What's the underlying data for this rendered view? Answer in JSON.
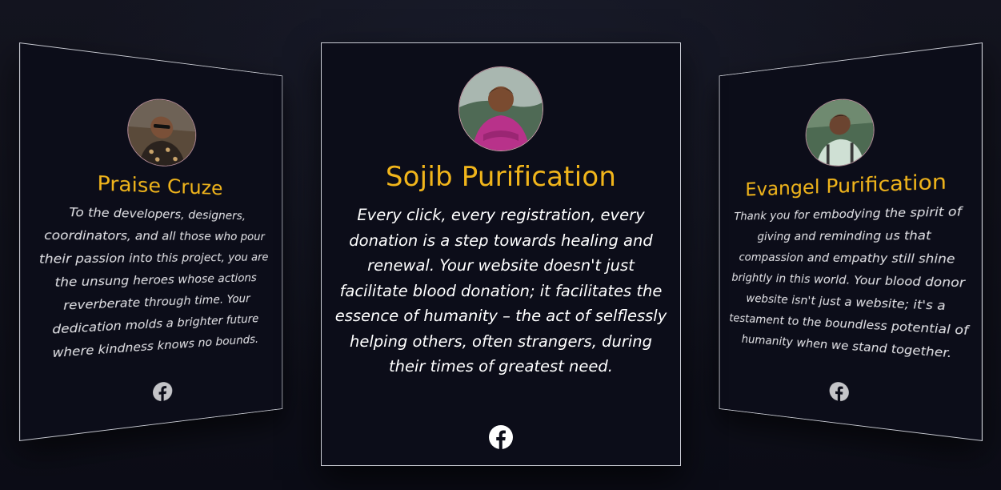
{
  "testimonials": {
    "left": {
      "name": "Praise Cruze",
      "quote": "To the developers, designers, coordinators, and all those who pour their passion into this project, you are the unsung heroes whose actions reverberate through time. Your dedication molds a brighter future where kindness knows no bounds.",
      "social_icon": "facebook-icon"
    },
    "center": {
      "name": "Sojib Purification",
      "quote": "Every click, every registration, every donation is a step towards healing and renewal. Your website doesn't just facilitate blood donation; it facilitates the essence of humanity – the act of selflessly helping others, often strangers, during their times of greatest need.",
      "social_icon": "facebook-icon"
    },
    "right": {
      "name": "Evangel Purification",
      "quote": "Thank you for embodying the spirit of giving and reminding us that compassion and empathy still shine brightly in this world. Your blood donor website isn't just a website; it's a testament to the boundless potential of humanity when we stand together.",
      "social_icon": "facebook-icon"
    }
  },
  "colors": {
    "background": "#0b0c16",
    "card_background": "#0c0d19",
    "card_border": "#c9cbd3",
    "name_accent": "#f1b51b",
    "text": "#ffffff",
    "avatar_ring": "#c79aa6"
  }
}
